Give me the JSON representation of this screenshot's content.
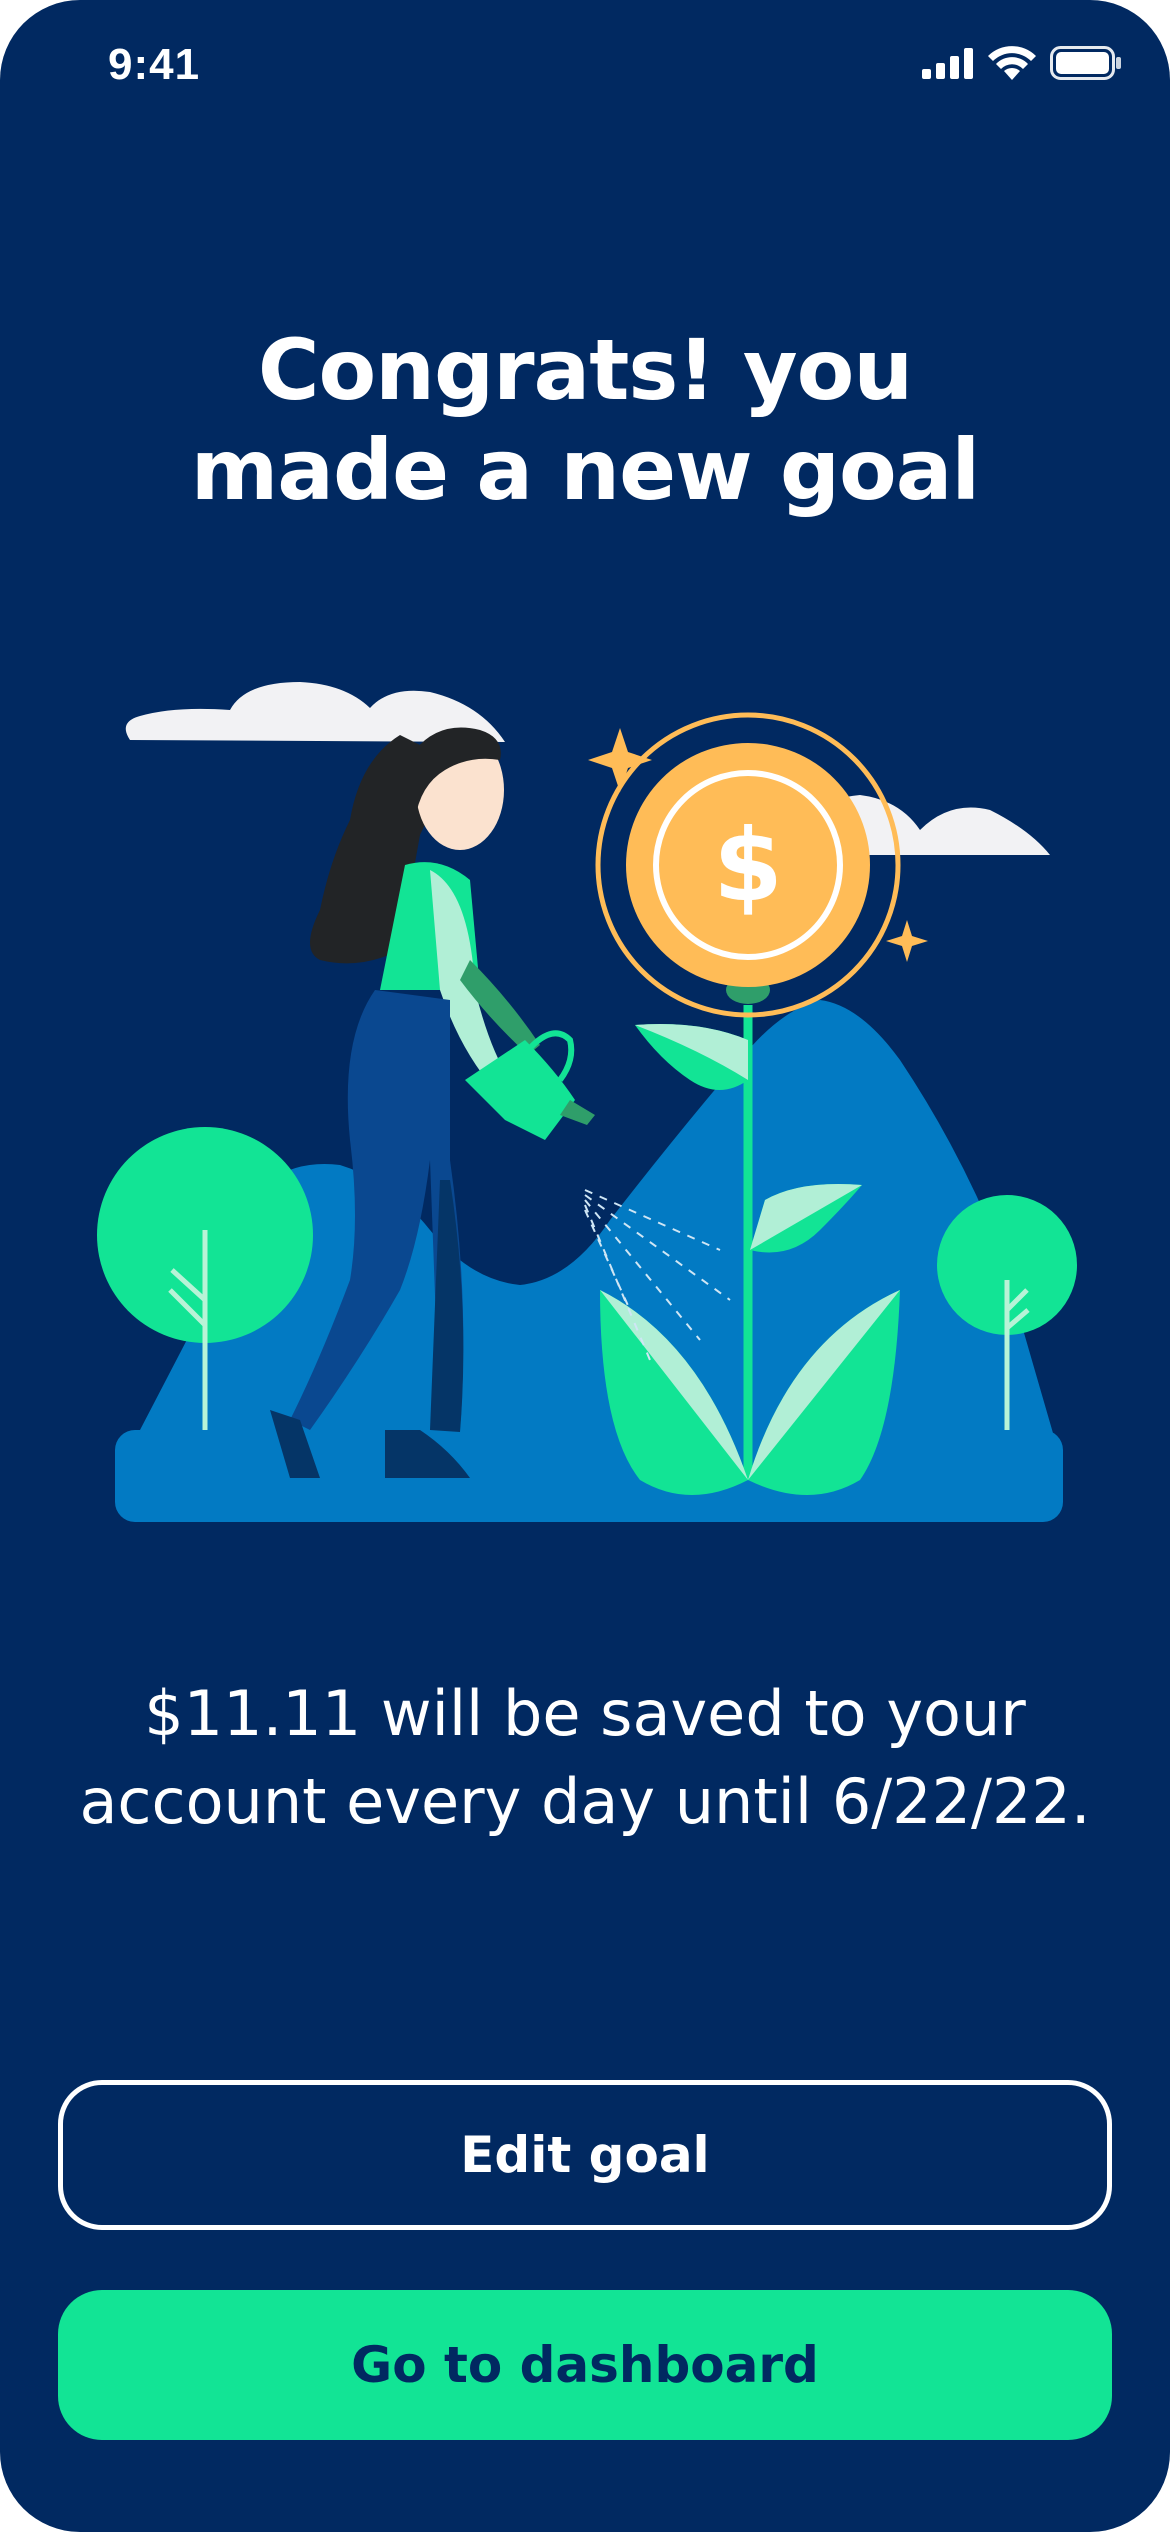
{
  "status_bar": {
    "time": "9:41",
    "icons": [
      "signal-icon",
      "wifi-icon",
      "battery-icon"
    ]
  },
  "title": {
    "line1": "Congrats! you",
    "line2": "made a new goal"
  },
  "illustration": {
    "coin_symbol": "$"
  },
  "message": {
    "line1": "$11.11 will be saved to your",
    "line2": "account every day until 6/22/22."
  },
  "buttons": {
    "edit_goal": "Edit goal",
    "go_to_dashboard": "Go to dashboard"
  },
  "colors": {
    "background": "#012961",
    "accent_green": "#12e495",
    "coin_orange": "#ffbc57",
    "mountain_blue": "#027ac3"
  }
}
